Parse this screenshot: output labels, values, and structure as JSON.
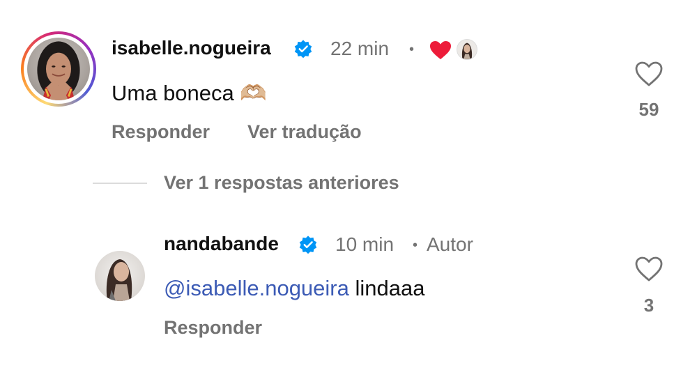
{
  "comments": [
    {
      "username": "isabelle.nogueira",
      "time": "22 min",
      "separator": "•",
      "text": "Uma boneca",
      "emoji": "🫶🏼",
      "like_count": "59",
      "reply_label": "Responder",
      "translate_label": "Ver tradução"
    },
    {
      "username": "nandabande",
      "time": "10 min",
      "separator": "•",
      "author_badge": "Autor",
      "mention": "@isabelle.nogueira",
      "text": "lindaaa",
      "like_count": "3",
      "reply_label": "Responder"
    }
  ],
  "thread": {
    "view_previous_replies": "Ver 1 respostas anteriores"
  },
  "colors": {
    "verified_blue": "#0095f6",
    "liked_heart": "#ed1c3a",
    "mention": "#3c5bb5",
    "muted_text": "#737373"
  }
}
